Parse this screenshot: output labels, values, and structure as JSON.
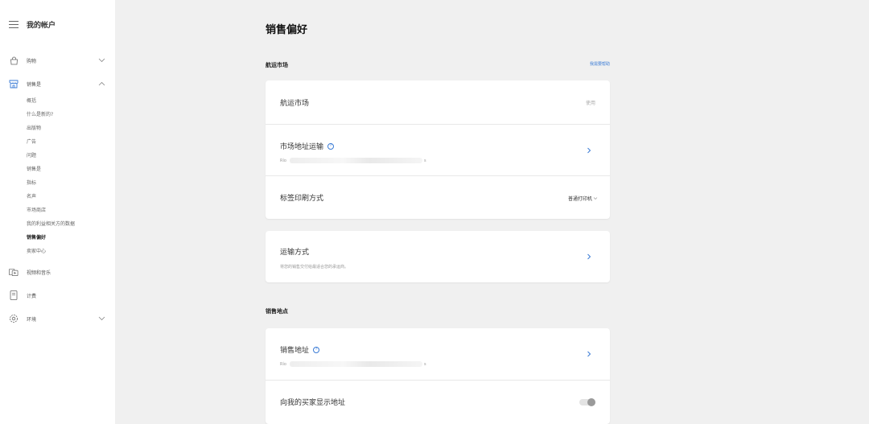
{
  "sidebar": {
    "title": "我的帐户",
    "nav": [
      {
        "label": "购物",
        "icon": "bag-icon",
        "expanded": false
      },
      {
        "label": "销售是",
        "icon": "store-icon",
        "expanded": true
      },
      {
        "label": "视频和音乐",
        "icon": "video-icon"
      },
      {
        "label": "计费",
        "icon": "document-icon"
      },
      {
        "label": "环境",
        "icon": "gear-icon",
        "expanded": false
      }
    ],
    "sub_items": [
      "概括",
      "什么是新的?",
      "出版物",
      "广告",
      "问题",
      "销售是",
      "指标",
      "名声",
      "市场商店",
      "我的利益相关方的数据",
      "销售偏好",
      "卖家中心"
    ],
    "active_sub": "销售偏好"
  },
  "main": {
    "title": "销售偏好",
    "shipping_section": {
      "heading": "航运市场",
      "help_link": "我需要帮助",
      "rows": {
        "market": {
          "title": "航运市场",
          "value": "使用"
        },
        "address": {
          "title": "市场地址运输",
          "sub_prefix": "Río",
          "sub_suffix": "s"
        },
        "label_print": {
          "title": "标签印刷方式",
          "value": "普通打印机"
        }
      }
    },
    "shipping_method": {
      "title": "运输方式",
      "subtitle": "将您的销售交付给最适合您的承运商。"
    },
    "sales_location": {
      "heading": "销售地点",
      "rows": {
        "address": {
          "title": "销售地址",
          "sub_prefix": "Río",
          "sub_suffix": "s"
        },
        "show_address": {
          "title": "向我的买家显示地址",
          "toggle_on": false
        }
      }
    },
    "accent_color": "#3a7bd5"
  }
}
